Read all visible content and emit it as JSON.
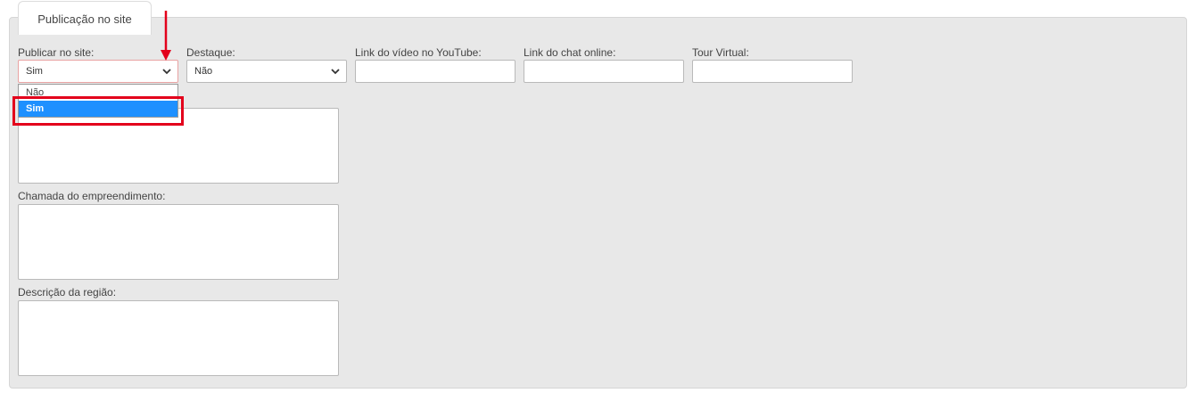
{
  "tab": {
    "label": "Publicação no site"
  },
  "fields": {
    "publicar": {
      "label": "Publicar no site:",
      "value": "Sim"
    },
    "destaque": {
      "label": "Destaque:",
      "value": "Não"
    },
    "youtube": {
      "label": "Link do vídeo no YouTube:",
      "value": ""
    },
    "chat": {
      "label": "Link do chat online:",
      "value": ""
    },
    "tour": {
      "label": "Tour Virtual:",
      "value": ""
    },
    "chamada": {
      "label": "Chamada do empreendimento:"
    },
    "regiao": {
      "label": "Descrição da região:"
    }
  },
  "dropdown": {
    "options": [
      "Não",
      "Sim"
    ],
    "selected": "Sim"
  },
  "colors": {
    "panel": "#e8e8e8",
    "selected_option": "#1e90ff",
    "annotation": "#e3001b"
  },
  "icons": {
    "select_arrow": "chevron-down-icon",
    "annotation_arrow": "arrow-down-icon"
  }
}
